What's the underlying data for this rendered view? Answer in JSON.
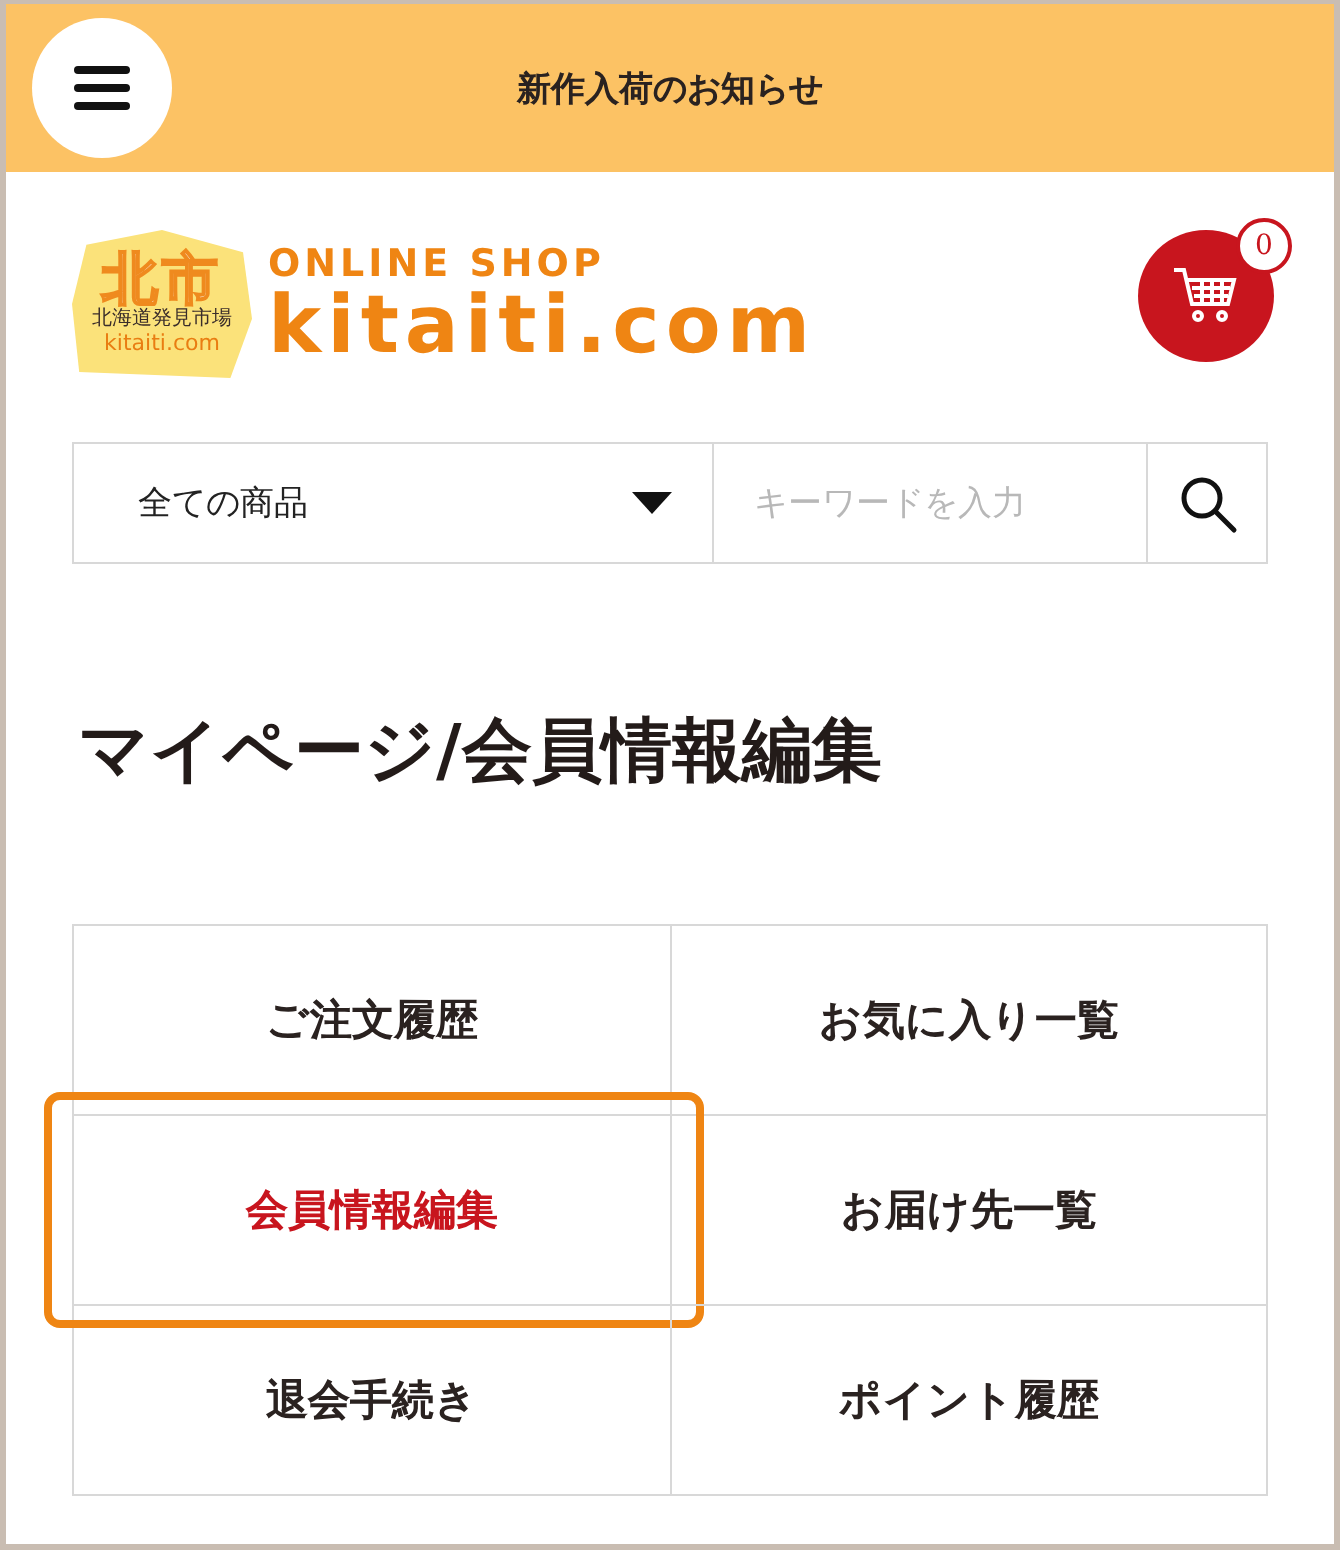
{
  "header": {
    "title": "新作入荷のお知らせ"
  },
  "logo": {
    "mark": "北市",
    "subtitle": "北海道発見市場",
    "mark_domain": "kitaiti.com",
    "tagline": "ONLINE SHOP",
    "site": "kitaiti.com"
  },
  "cart": {
    "count": "0"
  },
  "search": {
    "category": "全ての商品",
    "placeholder": "キーワードを入力"
  },
  "page_title": "マイページ/会員情報編集",
  "menu": [
    {
      "label": "ご注文履歴",
      "selected": false
    },
    {
      "label": "お気に入り一覧",
      "selected": false
    },
    {
      "label": "会員情報編集",
      "selected": true
    },
    {
      "label": "お届け先一覧",
      "selected": false
    },
    {
      "label": "退会手続き",
      "selected": false
    },
    {
      "label": "ポイント履歴",
      "selected": false
    }
  ]
}
